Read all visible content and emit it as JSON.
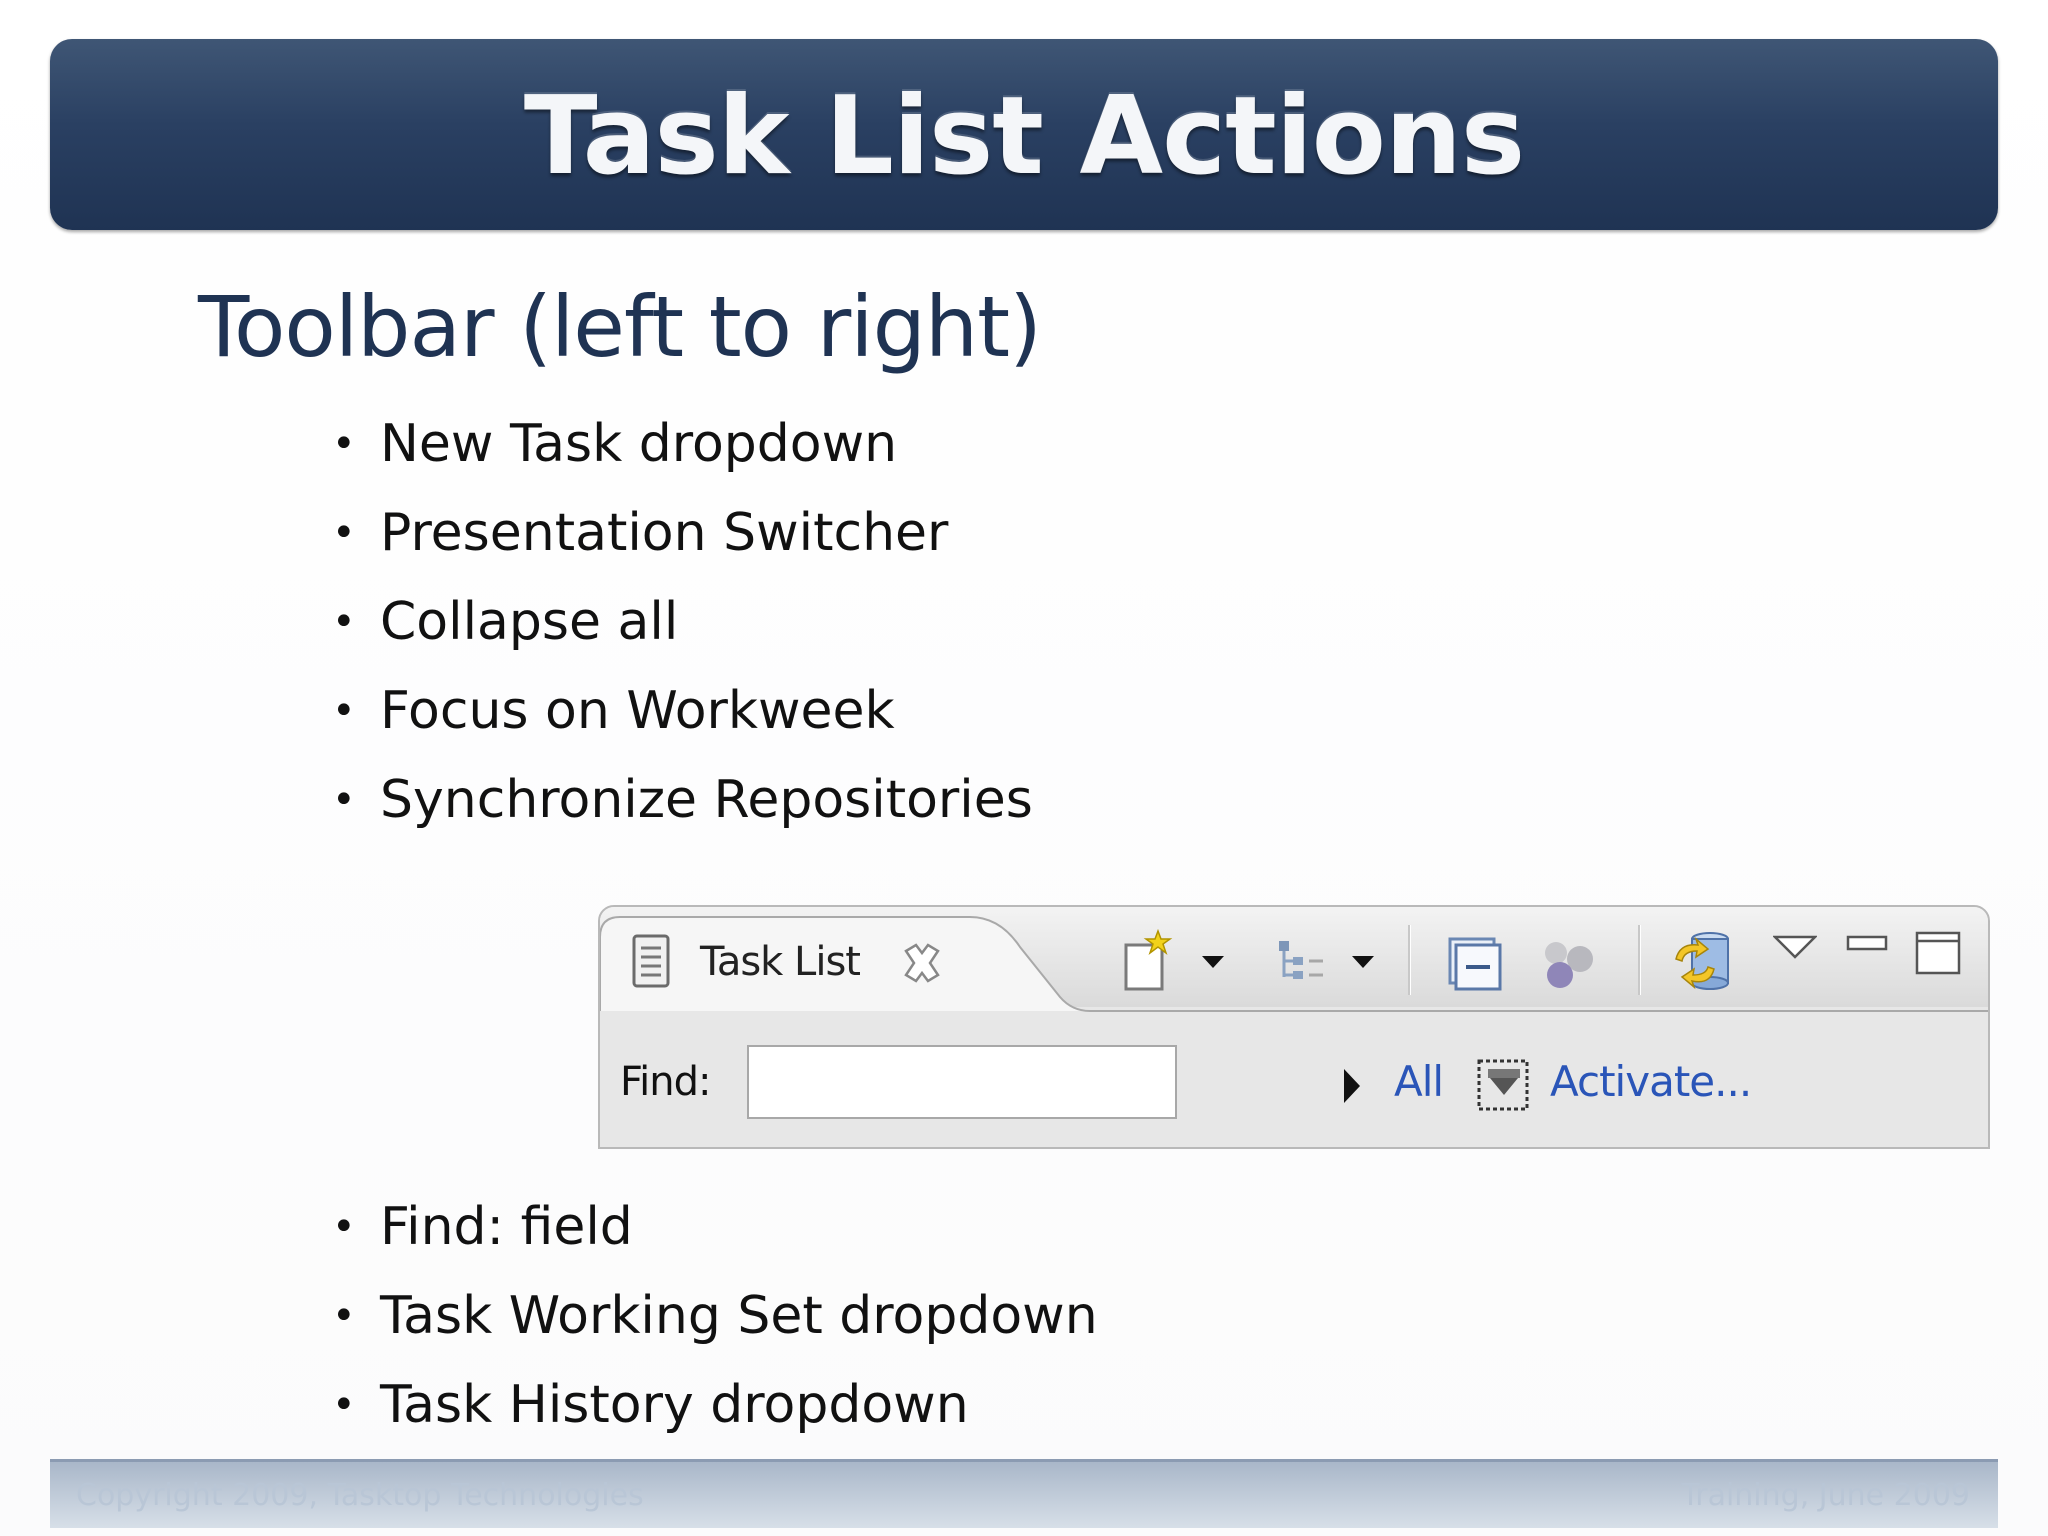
{
  "slide": {
    "title": "Task List Actions",
    "subtitle": "Toolbar (left to right)",
    "bullets_toolbar": [
      "New Task dropdown",
      "Presentation Switcher",
      "Collapse all",
      "Focus on Workweek",
      "Synchronize Repositories"
    ],
    "bullets_find": [
      "Find: field",
      "Task Working Set dropdown",
      "Task History dropdown"
    ],
    "footer_left": "Copyright 2009, Tasktop Technologies",
    "footer_right": "Training, June 2009"
  },
  "view": {
    "tab_label": "Task List",
    "find_label": "Find:",
    "find_value": "",
    "all_link": "All",
    "activate_link": "Activate...",
    "icons": [
      "task-list-icon",
      "close-icon",
      "new-task-icon",
      "dropdown-arrow-icon",
      "presentation-switcher-icon",
      "collapse-all-icon",
      "focus-workweek-icon",
      "synchronize-icon",
      "view-menu-icon",
      "minimize-icon",
      "maximize-icon",
      "triangle-right-icon",
      "task-history-icon"
    ],
    "link_color": "#2a55b8"
  }
}
